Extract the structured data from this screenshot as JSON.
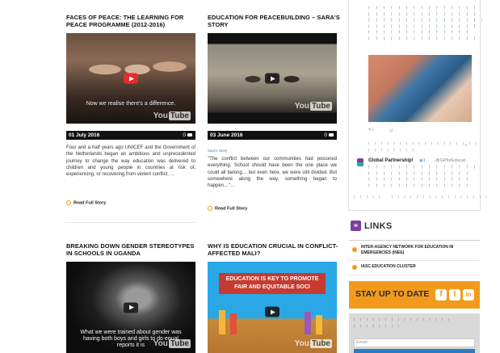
{
  "posts": [
    {
      "title": "FACES OF PEACE: THE LEARNING FOR PEACE PROGRAMME (2012-2016)",
      "video_caption": "Now we realise there's a difference.",
      "date": "01 July 2016",
      "comments": "0",
      "excerpt": "Four and a half years ago UNICEF and the Government of the Netherlands began an ambitious and unprecedented journey to change the way education was delivered to children and young people in countries at risk of, experiencing, or recovering from violent conflict. …",
      "read_more": "Read Full Story"
    },
    {
      "title": "EDUCATION FOR PEACEBUILDING – SARA'S STORY",
      "date": "03 June 2016",
      "comments": "0",
      "category": "Sara's Story",
      "excerpt": "\"The conflict between our communities had poisoned everything. School should have been the one place we could all belong… but even here, we were still divided. But somewhere along the way, something began to happen…\"…",
      "read_more": "Read Full Story"
    },
    {
      "title": "BREAKING DOWN GENDER STEREOTYPES IN SCHOOLS IN UGANDA",
      "video_caption": "What we were trained about gender was having both boys and girls to do equal reports it is"
    },
    {
      "title": "WHY IS EDUCATION CRUCIAL IN CONFLICT-AFFECTED MALI?",
      "video_caption": "EDUCATION IS KEY TO PROMOTE FAIR AND EQUITABLE SOCI"
    }
  ],
  "youtube_label": "You",
  "youtube_label_box": "Tube",
  "twitter": {
    "account_name": "Global Partnership!",
    "handle": "@GPforEducat",
    "like_count": "1",
    "verified_count": "1"
  },
  "links": {
    "heading": "LINKS",
    "items": [
      "INTER-AGENCY NETWORK FOR EDUCATION IN EMERGENCIES (INEE)",
      "IASC EDUCATION CLUSTER"
    ]
  },
  "stay_up_to_date": {
    "heading": "STAY UP TO DATE",
    "email_placeholder": "Email"
  },
  "colors": {
    "accent": "#f29a1e",
    "youtube_red": "#e52d27",
    "bar_blue": "#6a8a99"
  }
}
